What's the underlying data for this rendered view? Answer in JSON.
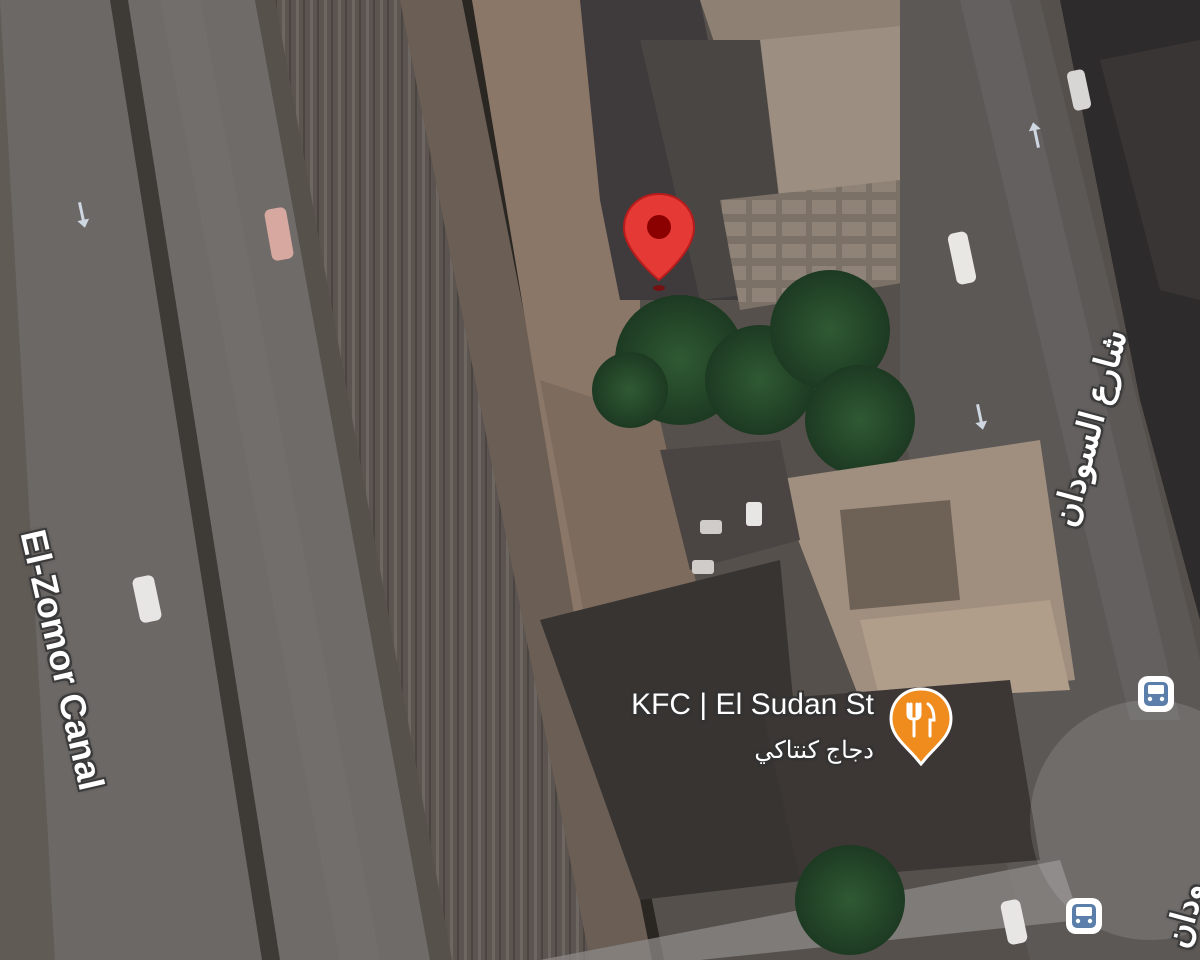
{
  "map": {
    "type": "satellite",
    "roads": {
      "canal_road": "El-Zomor Canal",
      "sudan_street_ar": "شارع السودان",
      "sudan_street_ar_partial": "ودان"
    },
    "places": [
      {
        "name": "KFC | El Sudan St",
        "name_ar": "دجاج كنتاكي",
        "category_icon": "restaurant-fork-knife-icon",
        "pin_color": "#f08c1e"
      }
    ],
    "selected_location_pin": {
      "icon": "red-location-pin-icon",
      "color": "#e53935"
    },
    "transit": [
      {
        "icon": "bus-stop-icon"
      },
      {
        "icon": "bus-stop-icon"
      }
    ]
  }
}
